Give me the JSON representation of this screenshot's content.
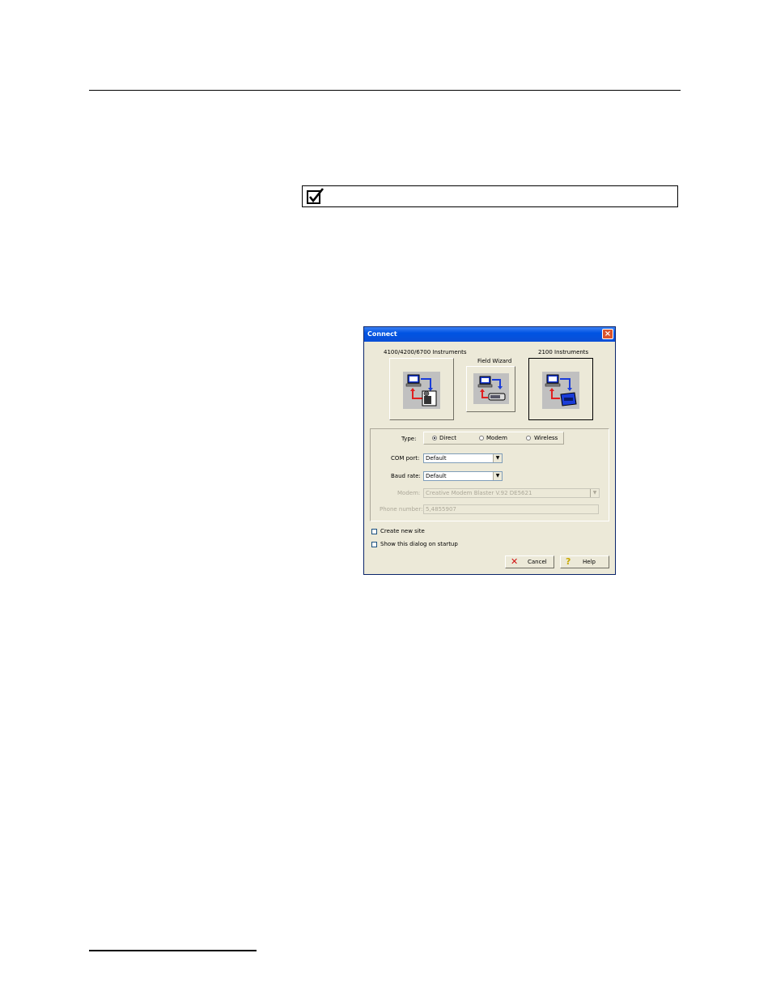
{
  "dialog": {
    "title": "Connect",
    "instruments": {
      "left_label": "4100/4200/6700 Instruments",
      "middle_label": "Field Wizard",
      "right_label": "2100 Instruments"
    },
    "type": {
      "label": "Type:",
      "options": [
        "Direct",
        "Modem",
        "Wireless"
      ],
      "selected": "Direct"
    },
    "com_port": {
      "label": "COM port:",
      "value": "Default"
    },
    "baud_rate": {
      "label": "Baud rate:",
      "value": "Default"
    },
    "modem": {
      "label": "Modem:",
      "value": "Creative Modem Blaster V.92 DE5621"
    },
    "phone_number": {
      "label": "Phone number:",
      "value": "5,4855907"
    },
    "create_new_site": "Create new site",
    "show_dialog": "Show this dialog on startup",
    "buttons": {
      "cancel": "Cancel",
      "help": "Help"
    }
  },
  "icons": [
    "checkbox-checked-icon",
    "close-icon",
    "computer-link-icon",
    "cancel-x-icon",
    "help-question-icon"
  ],
  "colors": {
    "titlebar": "#0054e3",
    "dialog_bg": "#ece9d8",
    "link_red": "#e02020",
    "link_blue": "#1a3cd8"
  }
}
